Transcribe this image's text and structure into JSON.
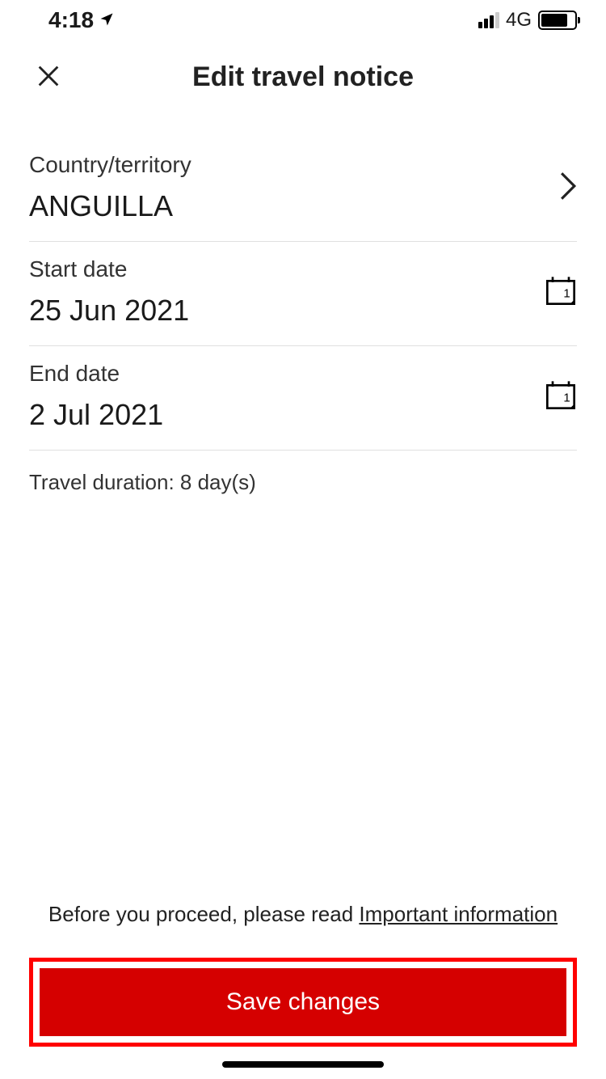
{
  "statusBar": {
    "time": "4:18",
    "network": "4G"
  },
  "header": {
    "title": "Edit travel notice"
  },
  "fields": {
    "country": {
      "label": "Country/territory",
      "value": "ANGUILLA"
    },
    "startDate": {
      "label": "Start date",
      "value": "25 Jun 2021"
    },
    "endDate": {
      "label": "End date",
      "value": "2 Jul 2021"
    }
  },
  "duration": "Travel duration: 8 day(s)",
  "footer": {
    "prompt": "Before you proceed, please read ",
    "link": "Important information",
    "saveLabel": "Save changes"
  }
}
